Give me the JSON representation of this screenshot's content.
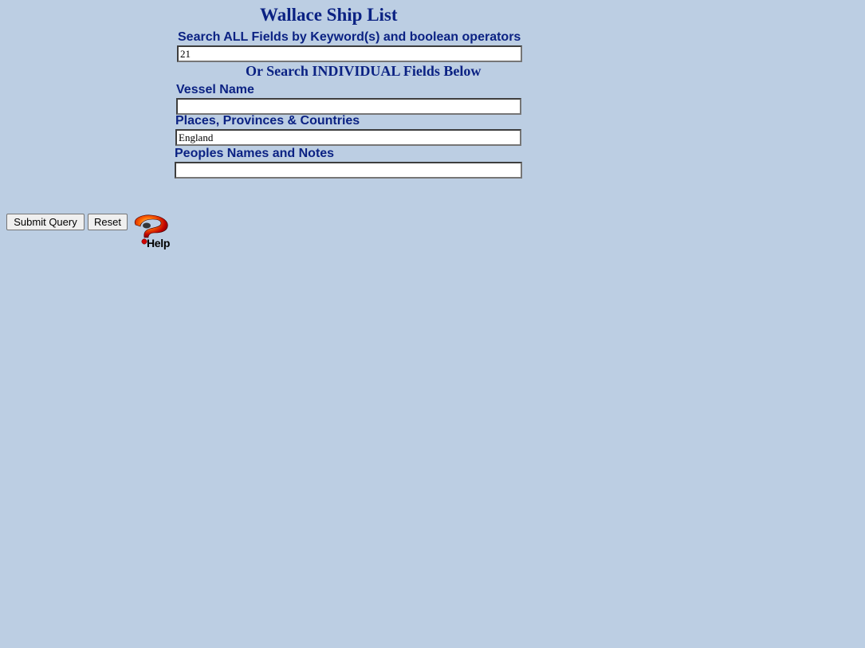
{
  "page": {
    "title": "Wallace Ship List"
  },
  "search_all": {
    "label": "Search ALL Fields by Keyword(s) and boolean operators",
    "value": "21"
  },
  "individual_heading": "Or Search INDIVIDUAL Fields Below",
  "fields": {
    "vessel_name": {
      "label": "Vessel Name",
      "value": ""
    },
    "places": {
      "label": "Places, Provinces & Countries",
      "value": "England"
    },
    "peoples": {
      "label": "Peoples Names and Notes",
      "value": ""
    }
  },
  "buttons": {
    "submit": "Submit Query",
    "reset": "Reset",
    "help": "Help"
  },
  "colors": {
    "background": "#bccee3",
    "heading_text": "#0b2283"
  },
  "icons": {
    "help": "help-question-mark-icon"
  }
}
